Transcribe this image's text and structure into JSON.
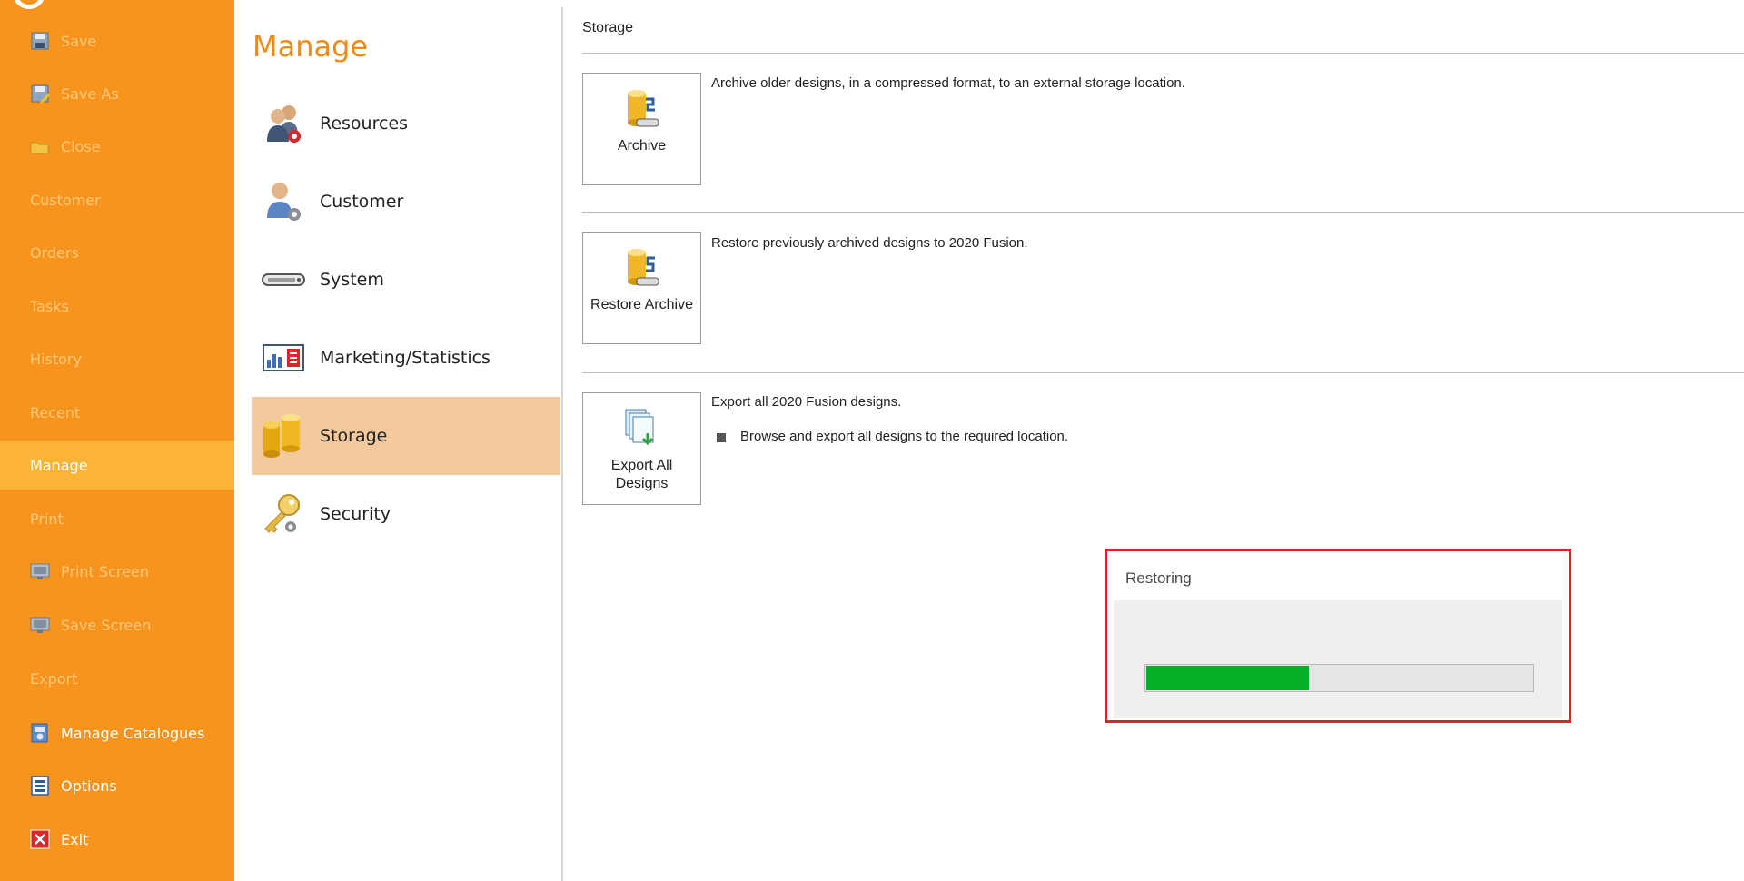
{
  "nav": {
    "items": [
      {
        "label": "Save",
        "icon": "save-icon",
        "enabled": false
      },
      {
        "label": "Save As",
        "icon": "save-as-icon",
        "enabled": false
      },
      {
        "label": "Close",
        "icon": "close-folder-icon",
        "enabled": false
      },
      {
        "label": "Customer",
        "icon": null,
        "enabled": false
      },
      {
        "label": "Orders",
        "icon": null,
        "enabled": false
      },
      {
        "label": "Tasks",
        "icon": null,
        "enabled": false
      },
      {
        "label": "History",
        "icon": null,
        "enabled": false
      },
      {
        "label": "Recent",
        "icon": null,
        "enabled": false
      },
      {
        "label": "Manage",
        "icon": null,
        "enabled": true,
        "active": true
      },
      {
        "label": "Print",
        "icon": null,
        "enabled": false
      },
      {
        "label": "Print Screen",
        "icon": "print-screen-icon",
        "enabled": false
      },
      {
        "label": "Save Screen",
        "icon": "save-screen-icon",
        "enabled": false
      },
      {
        "label": "Export",
        "icon": null,
        "enabled": false
      },
      {
        "label": "Manage Catalogues",
        "icon": "catalogue-icon",
        "enabled": true
      },
      {
        "label": "Options",
        "icon": "options-icon",
        "enabled": true
      },
      {
        "label": "Exit",
        "icon": "exit-icon",
        "enabled": true
      }
    ],
    "colors": {
      "background": "#f7941d",
      "active": "#fcb336",
      "disabled_text": "#ffc777"
    }
  },
  "manage": {
    "title": "Manage",
    "categories": [
      {
        "label": "Resources",
        "icon": "resources-users-icon"
      },
      {
        "label": "Customer",
        "icon": "customer-user-icon"
      },
      {
        "label": "System",
        "icon": "system-drive-icon"
      },
      {
        "label": "Marketing/Statistics",
        "icon": "statistics-chart-icon"
      },
      {
        "label": "Storage",
        "icon": "storage-cylinders-icon",
        "active": true
      },
      {
        "label": "Security",
        "icon": "security-key-icon"
      }
    ]
  },
  "storage": {
    "title": "Storage",
    "actions": [
      {
        "label": "Archive",
        "icon": "archive-icon",
        "description": "Archive older designs, in a compressed format, to an external storage location."
      },
      {
        "label": "Restore Archive",
        "icon": "restore-archive-icon",
        "description": "Restore previously archived designs to 2020 Fusion."
      },
      {
        "label_line1": "Export All",
        "label_line2": "Designs",
        "icon": "export-designs-icon",
        "description": "Export all 2020 Fusion designs.",
        "bullet": "Browse and export all designs to the required location."
      }
    ]
  },
  "dialog": {
    "title": "Restoring",
    "progress": 0.42,
    "progress_color": "#06b025",
    "highlight_color": "#d9262c"
  }
}
